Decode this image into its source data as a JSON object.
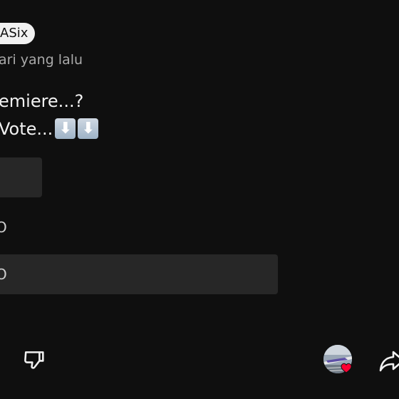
{
  "post": {
    "channel_name": "ASix",
    "timestamp": "ari yang lalu",
    "text_line1": "emiere...?",
    "text_line2": "Vote...",
    "emoji": [
      "⬇",
      "⬇"
    ]
  },
  "poll": {
    "options": [
      {
        "label": "O"
      },
      {
        "label": "O"
      }
    ]
  },
  "actions": {
    "dislike_icon": "thumbs-down-icon",
    "share_icon": "share-icon",
    "avatar_icon": "avatar"
  },
  "colors": {
    "background": "#0f0f0f",
    "chip_bg": "#f1f1f1",
    "option_bg": "#272727",
    "text": "#f1f1f1",
    "muted": "#aaaaaa",
    "heart": "#ff0033"
  }
}
